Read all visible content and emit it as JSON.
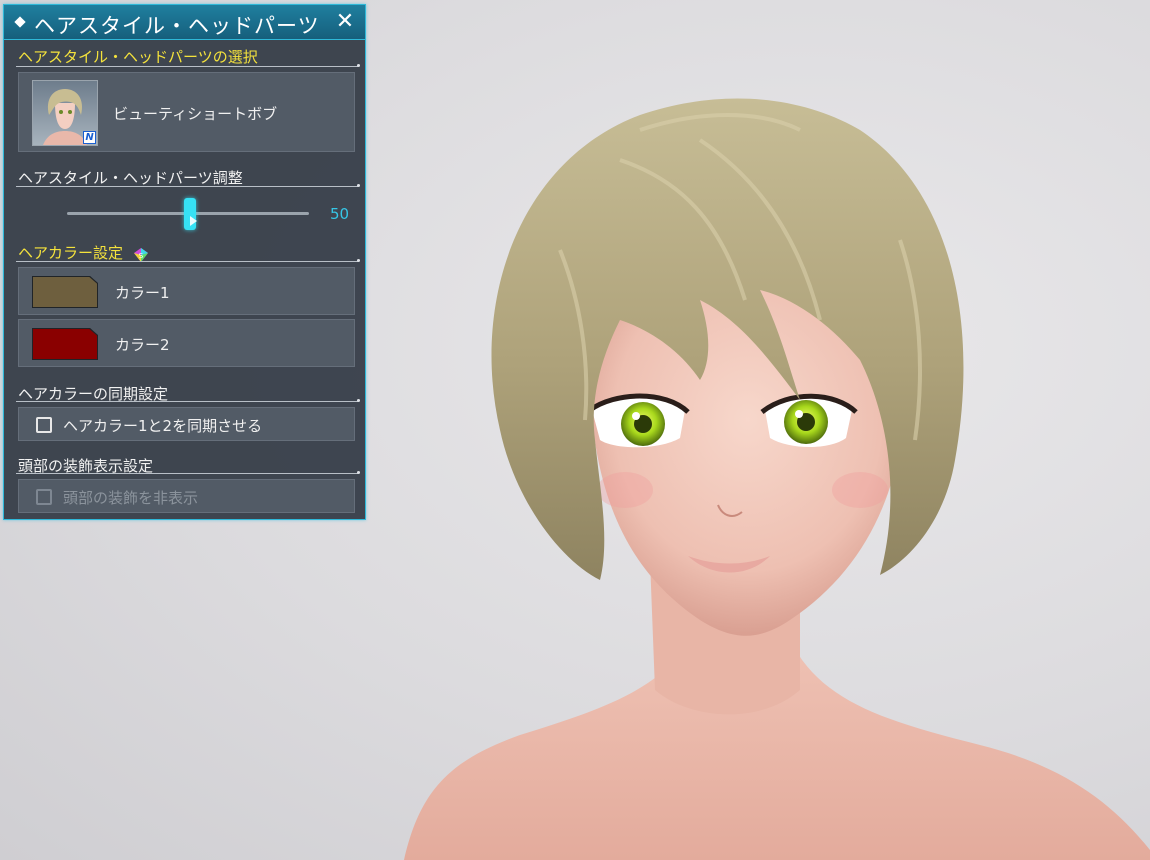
{
  "panel": {
    "title": "ヘアスタイル・ヘッドパーツ",
    "close_symbol": "✕"
  },
  "selection": {
    "section_title": "ヘアスタイル・ヘッドパーツの選択",
    "item_name": "ビューティショートボブ",
    "badge": "N"
  },
  "adjust": {
    "section_title": "ヘアスタイル・ヘッドパーツ調整",
    "value": 50,
    "value_label": "50",
    "min": 0,
    "max": 100
  },
  "hair_color": {
    "section_title": "ヘアカラー設定",
    "colors": [
      {
        "label": "カラー1",
        "hex": "#6e5f3e"
      },
      {
        "label": "カラー2",
        "hex": "#8a0000"
      }
    ]
  },
  "sync": {
    "section_title": "ヘアカラーの同期設定",
    "checkbox_label": "ヘアカラー1と2を同期させる",
    "checked": false
  },
  "head_accessory": {
    "section_title": "頭部の装飾表示設定",
    "checkbox_label": "頭部の装飾を非表示",
    "checked": false,
    "enabled": false
  },
  "theme": {
    "accent": "#2fb8d8",
    "section_highlight": "#f4e23c",
    "slider": "#36e2f5"
  },
  "icons": {
    "title": "diamond-icon",
    "close": "close-icon",
    "gem": "rainbow-gem-icon"
  }
}
